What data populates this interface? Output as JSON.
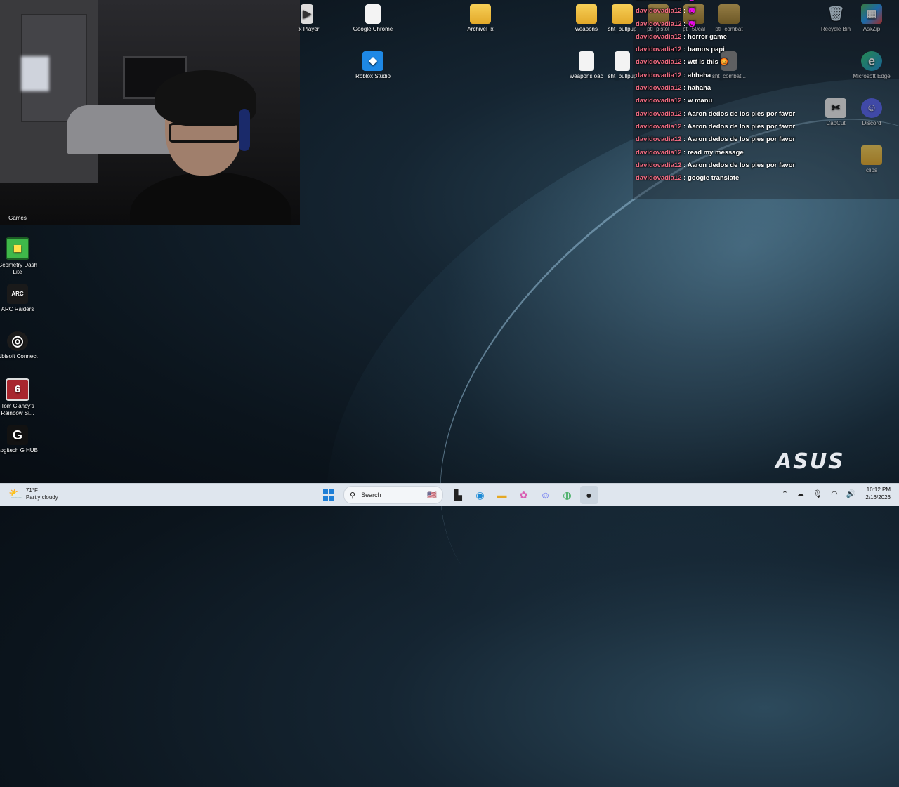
{
  "desktop_icons_left": [
    {
      "label": "Games",
      "glyph": "",
      "icon": "games-icon"
    },
    {
      "label": "Geometry Dash Lite",
      "glyph": "◼",
      "icon": "geometry-dash-icon"
    },
    {
      "label": "ARC Raiders",
      "glyph": "ARC",
      "icon": "arc-raiders-icon"
    },
    {
      "label": "Ubisoft Connect",
      "glyph": "◎",
      "icon": "ubisoft-icon"
    },
    {
      "label": "Tom Clancy's Rainbow Si...",
      "glyph": "6",
      "icon": "rainbow-six-icon"
    },
    {
      "label": "Logitech G HUB",
      "glyph": "G",
      "icon": "logitech-icon"
    }
  ],
  "desktop_icons_top": [
    {
      "label": "x Player",
      "glyph": "▶",
      "icon": "player-icon"
    },
    {
      "label": "Google Chrome",
      "glyph": "",
      "icon": "file-icon"
    },
    {
      "label": "Roblox Studio",
      "glyph": "◆",
      "icon": "roblox-studio-icon"
    },
    {
      "label": "ArchiveFix",
      "glyph": "",
      "icon": "folder-icon"
    },
    {
      "label": "weapons",
      "glyph": "",
      "icon": "folder-icon"
    },
    {
      "label": "sht_bullpup",
      "glyph": "",
      "icon": "folder-icon"
    },
    {
      "label": "ptl_pistol",
      "glyph": "",
      "icon": "folder-icon"
    },
    {
      "label": "ptl_50cal",
      "glyph": "",
      "icon": "folder-icon"
    },
    {
      "label": "ptl_combat",
      "glyph": "",
      "icon": "folder-icon"
    },
    {
      "label": "weapons.oac",
      "glyph": "",
      "icon": "file-icon"
    },
    {
      "label": "sht_bullpup",
      "glyph": "",
      "icon": "file-icon"
    },
    {
      "label": "sht_combat...",
      "glyph": "",
      "icon": "file-icon"
    }
  ],
  "desktop_icons_right": [
    {
      "label": "Recycle Bin",
      "glyph": "🗑",
      "icon": "recycle-bin-icon"
    },
    {
      "label": "AskZip",
      "glyph": "▦",
      "icon": "askzip-icon"
    },
    {
      "label": "Microsoft Edge",
      "glyph": "e",
      "icon": "edge-icon"
    },
    {
      "label": "CapCut",
      "glyph": "✂",
      "icon": "capcut-icon"
    },
    {
      "label": "Discord",
      "glyph": "☺",
      "icon": "discord-icon"
    },
    {
      "label": "clips",
      "glyph": "",
      "icon": "folder-icon"
    }
  ],
  "chat": {
    "messages": [
      {
        "user": "davidovadia12",
        "text": "😈"
      },
      {
        "user": "davidovadia12",
        "text": "😈"
      },
      {
        "user": "davidovadia12",
        "text": "😈"
      },
      {
        "user": "davidovadia12",
        "text": "horror game"
      },
      {
        "user": "davidovadia12",
        "text": "bamos papi"
      },
      {
        "user": "davidovadia12",
        "text": "wtf is this 😡"
      },
      {
        "user": "davidovadia12",
        "text": "ahhaha"
      },
      {
        "user": "davidovadia12",
        "text": "hahaha"
      },
      {
        "user": "davidovadia12",
        "text": "w manu"
      },
      {
        "user": "davidovadia12",
        "text": "Aaron dedos de los pies por favor"
      },
      {
        "user": "davidovadia12",
        "text": "Aaron dedos de los pies por favor"
      },
      {
        "user": "davidovadia12",
        "text": "Aaron dedos de los pies por favor"
      },
      {
        "user": "davidovadia12",
        "text": "read my message"
      },
      {
        "user": "davidovadia12",
        "text": "Aaron dedos de los pies por favor"
      },
      {
        "user": "davidovadia12",
        "text": "google translate"
      }
    ],
    "separator": " : "
  },
  "brand": {
    "text": "ASUS"
  },
  "taskbar": {
    "weather_temp": "71°F",
    "weather_desc": "Partly cloudy",
    "search_placeholder": "Search",
    "time": "10:12 PM",
    "date": "2/16/2026"
  },
  "colors": {
    "chat_username": "#f06b82",
    "taskbar_bg": "#dfe6ee"
  }
}
